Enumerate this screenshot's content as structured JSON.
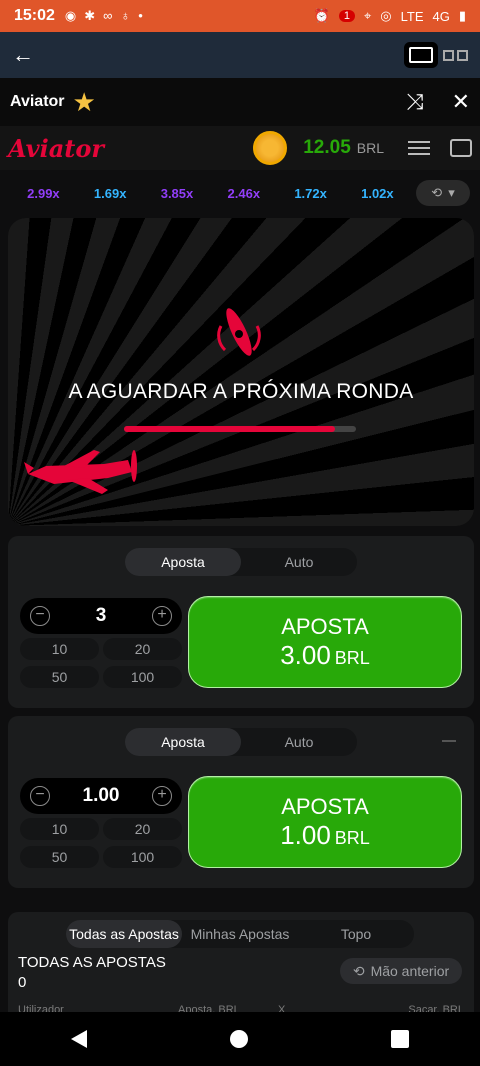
{
  "status_bar": {
    "time": "15:02",
    "notif_count": "1",
    "network": "4G",
    "network_sub": "LTE"
  },
  "header": {
    "title": "Aviator"
  },
  "logo": {
    "text": "Aviator"
  },
  "balance": {
    "amount": "12.05",
    "currency": "BRL"
  },
  "multipliers": [
    {
      "value": "2.99x",
      "color": "#913ef8"
    },
    {
      "value": "1.69x",
      "color": "#34b4ff"
    },
    {
      "value": "3.85x",
      "color": "#913ef8"
    },
    {
      "value": "2.46x",
      "color": "#913ef8"
    },
    {
      "value": "1.72x",
      "color": "#34b4ff"
    },
    {
      "value": "1.02x",
      "color": "#34b4ff"
    }
  ],
  "stage": {
    "message": "A AGUARDAR A PRÓXIMA RONDA",
    "progress": 0.91
  },
  "bet1": {
    "tab_bet": "Aposta",
    "tab_auto": "Auto",
    "value": "3",
    "quick": [
      "10",
      "20",
      "50",
      "100"
    ],
    "button_label": "APOSTA",
    "button_amount": "3.00",
    "button_currency": "BRL"
  },
  "bet2": {
    "tab_bet": "Aposta",
    "tab_auto": "Auto",
    "value": "1.00",
    "quick": [
      "10",
      "20",
      "50",
      "100"
    ],
    "button_label": "APOSTA",
    "button_amount": "1.00",
    "button_currency": "BRL"
  },
  "bets": {
    "tabs": [
      "Todas as Apostas",
      "Minhas Apostas",
      "Topo"
    ],
    "title": "TODAS AS APOSTAS",
    "count": "0",
    "prev_button": "Mão anterior",
    "columns": [
      "Utilizador",
      "Aposta, BRL",
      "X",
      "Sacar, BRL"
    ]
  },
  "colors": {
    "accent_red": "#e50539",
    "green": "#28a909",
    "purple": "#913ef8",
    "blue": "#34b4ff"
  }
}
